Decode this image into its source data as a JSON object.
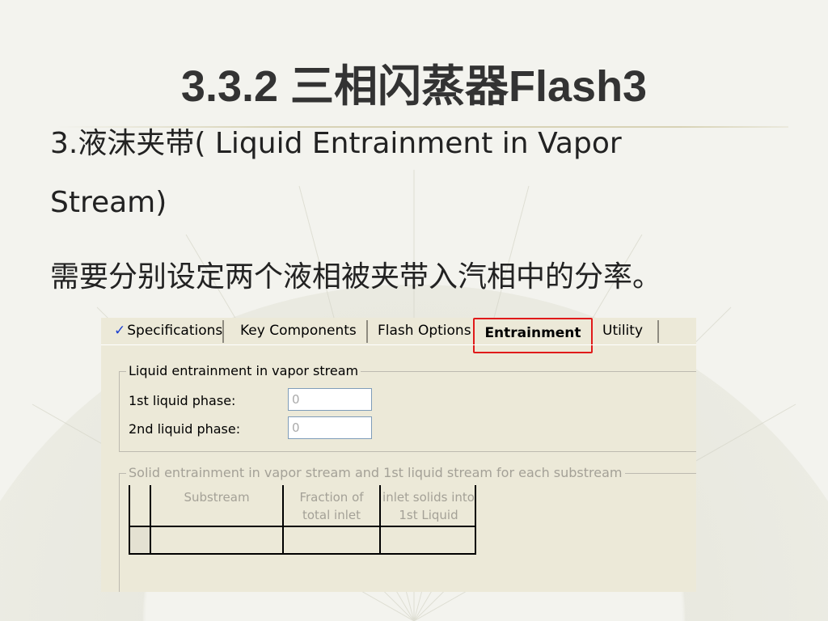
{
  "slide": {
    "title": "3.3.2 三相闪蒸器Flash3",
    "line1": "3.液沫夹带( Liquid Entrainment in Vapor",
    "line2": "Stream)",
    "line3": "需要分别设定两个液相被夹带入汽相中的分率。"
  },
  "dialog": {
    "tabs": [
      {
        "label": "Specifications",
        "checked": true
      },
      {
        "label": "Key Components"
      },
      {
        "label": "Flash Options"
      },
      {
        "label": "Entrainment",
        "active": true,
        "highlight": "#e01a1a"
      },
      {
        "label": "Utility"
      }
    ],
    "liquid_group": {
      "legend": "Liquid entrainment in vapor stream",
      "first_label": "1st liquid phase:",
      "first_value": "0",
      "second_label": "2nd liquid phase:",
      "second_value": "0"
    },
    "solid_group": {
      "legend": "Solid entrainment in vapor stream and 1st liquid stream for each substream",
      "columns": [
        "Substream",
        "Fraction of total inlet solids into Vapor",
        "inlet solids into 1st Liquid"
      ]
    }
  }
}
